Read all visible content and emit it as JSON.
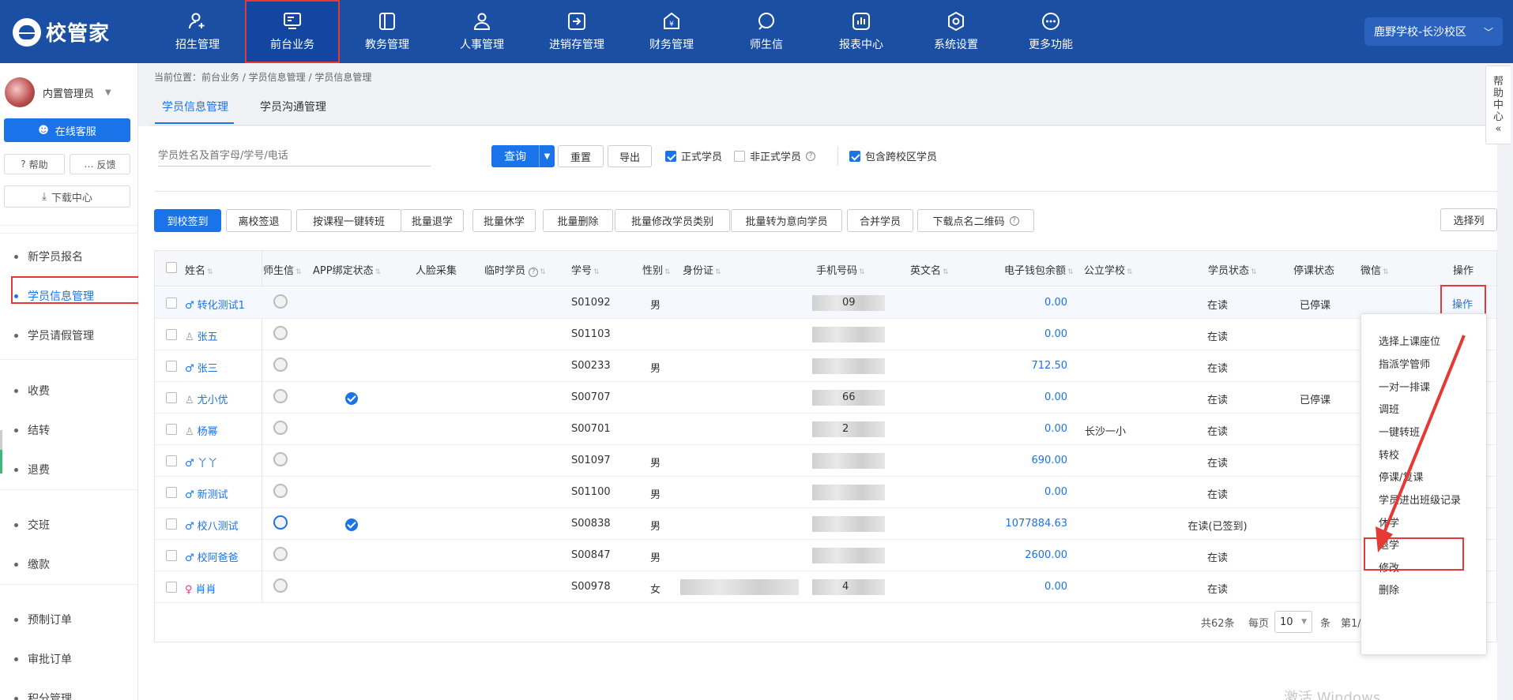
{
  "app": {
    "logo_text": "校管家",
    "campus": "鹿野学校-长沙校区"
  },
  "nav": [
    {
      "label": "招生管理",
      "icon": "user-add-icon"
    },
    {
      "label": "前台业务",
      "icon": "monitor-icon",
      "active": true
    },
    {
      "label": "教务管理",
      "icon": "book-icon"
    },
    {
      "label": "人事管理",
      "icon": "person-icon"
    },
    {
      "label": "进销存管理",
      "icon": "inventory-icon"
    },
    {
      "label": "财务管理",
      "icon": "finance-icon"
    },
    {
      "label": "师生信",
      "icon": "chat-icon"
    },
    {
      "label": "报表中心",
      "icon": "report-icon"
    },
    {
      "label": "系统设置",
      "icon": "settings-icon"
    },
    {
      "label": "更多功能",
      "icon": "more-icon"
    }
  ],
  "sidebar": {
    "user_name": "内置管理员",
    "service_button": "在线客服",
    "help": "帮助",
    "feedback": "反馈",
    "download_center": "下载中心",
    "items": [
      "新学员报名",
      "学员信息管理",
      "学员请假管理",
      "收费",
      "结转",
      "退费",
      "交班",
      "缴款",
      "预制订单",
      "审批订单",
      "积分管理"
    ],
    "active_item": "学员信息管理"
  },
  "breadcrumb": "当前位置：前台业务 / 学员信息管理 / 学员信息管理",
  "tabs": [
    "学员信息管理",
    "学员沟通管理"
  ],
  "filters": {
    "search_placeholder": "学员姓名及首字母/学号/电话",
    "query": "查询",
    "reset": "重置",
    "export": "导出",
    "formal": "正式学员",
    "informal": "非正式学员",
    "cross_campus": "包含跨校区学员"
  },
  "actions": [
    "到校签到",
    "离校签退",
    "按课程一键转班",
    "批量退学",
    "批量休学",
    "批量删除",
    "批量修改学员类别",
    "批量转为意向学员",
    "合并学员",
    "下载点名二维码"
  ],
  "select_columns": "选择列",
  "columns": {
    "name": "姓名",
    "teacher_msg": "师生信",
    "app_bind": "APP绑定状态",
    "face": "人脸采集",
    "temp": "临时学员",
    "sid": "学号",
    "gender": "性别",
    "id_card": "身份证",
    "phone": "手机号码",
    "en_name": "英文名",
    "wallet": "电子钱包余额",
    "public_school": "公立学校",
    "status": "学员状态",
    "suspend": "停课状态",
    "wechat": "微信",
    "op": "操作"
  },
  "rows": [
    {
      "name": "转化测试1",
      "sex": "m",
      "sid": "S01092",
      "gender": "男",
      "phone": "09",
      "wallet": "0.00",
      "school": "",
      "status": "在读",
      "suspend": "已停课",
      "bound": false,
      "wx_on": false
    },
    {
      "name": "张五",
      "sex": "u",
      "sid": "S01103",
      "gender": "",
      "phone": "",
      "wallet": "0.00",
      "school": "",
      "status": "在读",
      "suspend": "",
      "bound": false,
      "wx_on": false
    },
    {
      "name": "张三",
      "sex": "m",
      "sid": "S00233",
      "gender": "男",
      "phone": "",
      "wallet": "712.50",
      "school": "",
      "status": "在读",
      "suspend": "",
      "bound": false,
      "wx_on": false
    },
    {
      "name": "尤小优",
      "sex": "u",
      "sid": "S00707",
      "gender": "",
      "phone": "66",
      "wallet": "0.00",
      "school": "",
      "status": "在读",
      "suspend": "已停课",
      "bound": true,
      "wx_on": false
    },
    {
      "name": "杨幂",
      "sex": "u",
      "sid": "S00701",
      "gender": "",
      "phone": "2",
      "wallet": "0.00",
      "school": "长沙一小",
      "status": "在读",
      "suspend": "",
      "bound": false,
      "wx_on": false
    },
    {
      "name": "丫丫",
      "sex": "m",
      "sid": "S01097",
      "gender": "男",
      "phone": "",
      "wallet": "690.00",
      "school": "",
      "status": "在读",
      "suspend": "",
      "bound": false,
      "wx_on": false
    },
    {
      "name": "新测试",
      "sex": "m",
      "sid": "S01100",
      "gender": "男",
      "phone": "",
      "wallet": "0.00",
      "school": "",
      "status": "在读",
      "suspend": "",
      "bound": false,
      "wx_on": false
    },
    {
      "name": "校八测试",
      "sex": "m",
      "sid": "S00838",
      "gender": "男",
      "phone": "",
      "wallet": "1077884.63",
      "school": "",
      "status": "在读(已签到)",
      "suspend": "",
      "bound": true,
      "wx_on": true
    },
    {
      "name": "校阿爸爸",
      "sex": "m",
      "sid": "S00847",
      "gender": "男",
      "phone": "",
      "wallet": "2600.00",
      "school": "",
      "status": "在读",
      "suspend": "",
      "bound": false,
      "wx_on": false
    },
    {
      "name": "肖肖",
      "sex": "f",
      "sid": "S00978",
      "gender": "女",
      "phone": "4",
      "wallet": "0.00",
      "school": "",
      "status": "在读",
      "suspend": "",
      "bound": false,
      "wx_on": false
    }
  ],
  "op_label": "操作",
  "menu": [
    "选择上课座位",
    "指派学管师",
    "一对一排课",
    "调班",
    "一键转班",
    "转校",
    "停课/复课",
    "学员进出班级记录",
    "休学",
    "退学",
    "修改",
    "删除"
  ],
  "pager": {
    "total": "共62条",
    "per_page": "每页",
    "size": "10",
    "unit": "条",
    "page": "第1/"
  },
  "help_tab": [
    "帮",
    "助",
    "中",
    "心",
    "«"
  ],
  "watermark": "激活 Windows"
}
